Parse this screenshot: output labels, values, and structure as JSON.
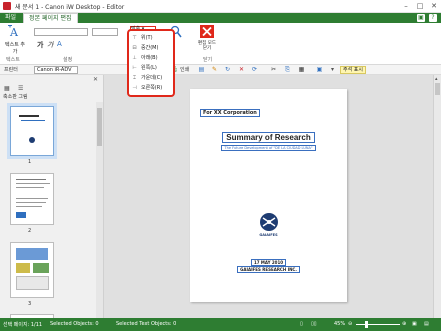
{
  "titlebar": {
    "title": "새 문서 1 - Canon iW Desktop - Editor",
    "minimize": "–",
    "maximize": "□",
    "close": "✕"
  },
  "tabs": [
    {
      "label": "파일"
    },
    {
      "label": "정본 페이지 편집"
    }
  ],
  "ribbon": {
    "text_add_label": "텍스트 추가",
    "text_group": "텍스트",
    "settings_group": "설정",
    "bold": "가",
    "italic": "가",
    "font_color": "A",
    "align_label": "맞춤",
    "close_label": "편집 모드 닫기",
    "close_group": "닫기"
  },
  "ribbon2": {
    "printer_label": "프린터",
    "printer_value": "Canon iR-ADV",
    "print_label": "인쇄",
    "note_label": "주석 표시"
  },
  "align_menu": {
    "items": [
      {
        "label": "위(T)",
        "icon": "align-top-icon"
      },
      {
        "label": "중간(M)",
        "icon": "align-middle-icon"
      },
      {
        "label": "아래(B)",
        "icon": "align-bottom-icon"
      },
      {
        "label": "왼쪽(L)",
        "icon": "align-left-icon"
      },
      {
        "label": "가운데(C)",
        "icon": "align-center-icon"
      },
      {
        "label": "오른쪽(R)",
        "icon": "align-right-icon"
      }
    ]
  },
  "left_panel": {
    "title": "축소판 그림",
    "close": "✕",
    "thumbnails": [
      {
        "number": "1"
      },
      {
        "number": "2"
      },
      {
        "number": "3"
      }
    ]
  },
  "document": {
    "header_box": "For XX Corporation",
    "title": "Summary of Research",
    "subtitle": "The Future Development of \"DE LA CIUDAD LUNA\"",
    "logo_text": "GAIAIFES",
    "date": "17 MAY 2010",
    "company": "GAIAIFES RESEARCH INC."
  },
  "status": {
    "page": "선택 페이지: 1/11",
    "objects": "Selected Objects: 0",
    "text_objects": "Selected Text Objects: 0",
    "zoom": "45%"
  },
  "colors": {
    "accent": "#2e7d32",
    "highlight": "#e0281a"
  }
}
